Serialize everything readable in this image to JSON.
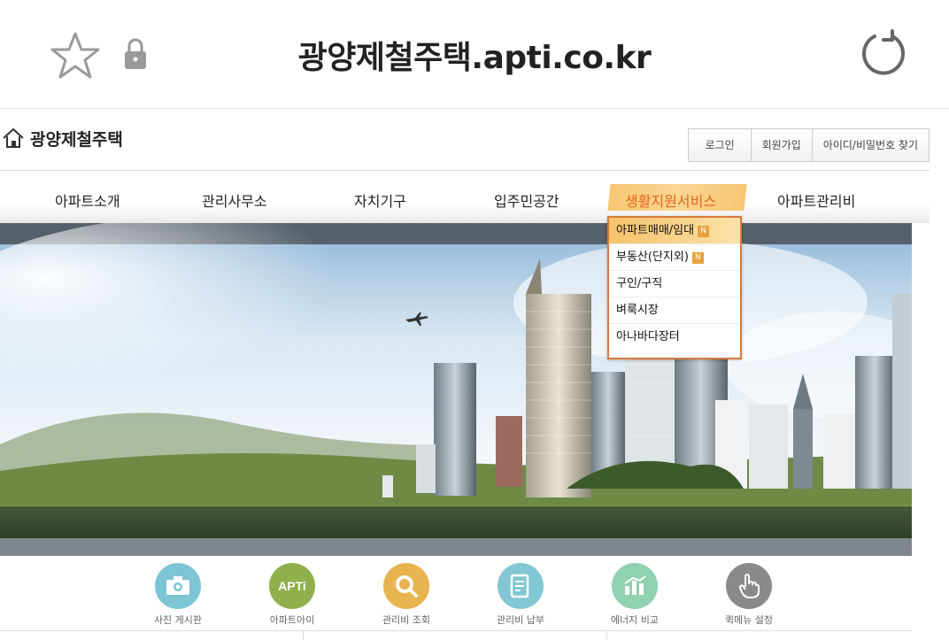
{
  "browser": {
    "url": "광양제철주택.apti.co.kr"
  },
  "site": {
    "name": "광양제철주택",
    "auth": [
      "로그인",
      "회원가입",
      "아이디/비밀번호 찾기"
    ]
  },
  "nav": {
    "items": [
      "아파트소개",
      "관리사무소",
      "자치기구",
      "입주민공간",
      "생활지원서비스",
      "아파트관리비"
    ],
    "active_index": 4
  },
  "dropdown": {
    "items": [
      {
        "label": "아파트매매/임대",
        "badge": "N"
      },
      {
        "label": "부동산(단지외)",
        "badge": "N"
      },
      {
        "label": "구인/구직",
        "badge": ""
      },
      {
        "label": "벼룩시장",
        "badge": ""
      },
      {
        "label": "아나바다장터",
        "badge": ""
      }
    ]
  },
  "quick": [
    {
      "label": "사진 게시판",
      "icon": "camera-icon",
      "color": "#7cc4d6"
    },
    {
      "label": "아파트아이",
      "icon": "apti-icon",
      "color": "#8fb04a",
      "text": "APTi"
    },
    {
      "label": "관리비 조회",
      "icon": "search-icon",
      "color": "#e8b450"
    },
    {
      "label": "관리비 납부",
      "icon": "document-icon",
      "color": "#82c7d3"
    },
    {
      "label": "에너지 비교",
      "icon": "energy-chart-icon",
      "color": "#8fd1b0"
    },
    {
      "label": "퀵메뉴 설정",
      "icon": "hand-icon",
      "color": "#8a8a8a"
    }
  ],
  "colors": {
    "accent": "#e3661a",
    "dropdown_border": "#d87a3a",
    "highlight": "#f6c36b"
  }
}
